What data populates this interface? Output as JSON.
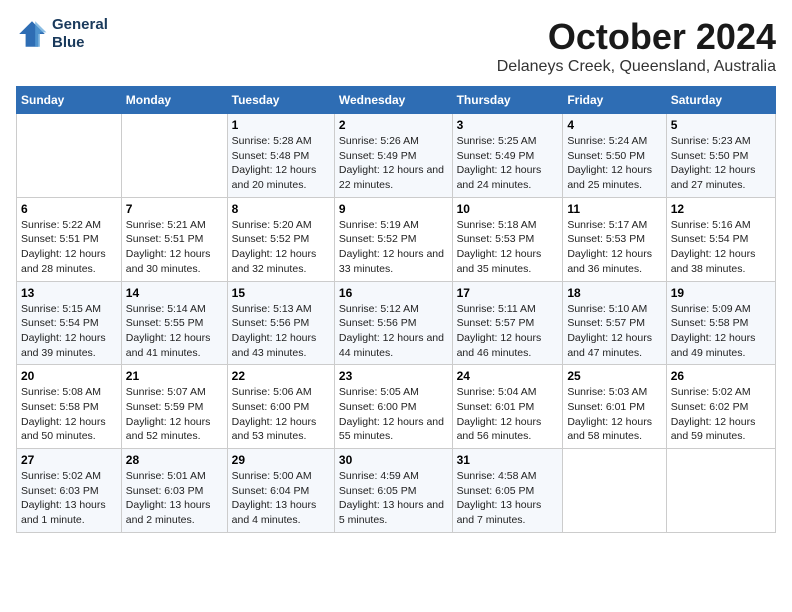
{
  "header": {
    "logo_line1": "General",
    "logo_line2": "Blue",
    "title": "October 2024",
    "subtitle": "Delaneys Creek, Queensland, Australia"
  },
  "weekdays": [
    "Sunday",
    "Monday",
    "Tuesday",
    "Wednesday",
    "Thursday",
    "Friday",
    "Saturday"
  ],
  "weeks": [
    [
      {
        "day": "",
        "sunrise": "",
        "sunset": "",
        "daylight": ""
      },
      {
        "day": "",
        "sunrise": "",
        "sunset": "",
        "daylight": ""
      },
      {
        "day": "1",
        "sunrise": "Sunrise: 5:28 AM",
        "sunset": "Sunset: 5:48 PM",
        "daylight": "Daylight: 12 hours and 20 minutes."
      },
      {
        "day": "2",
        "sunrise": "Sunrise: 5:26 AM",
        "sunset": "Sunset: 5:49 PM",
        "daylight": "Daylight: 12 hours and 22 minutes."
      },
      {
        "day": "3",
        "sunrise": "Sunrise: 5:25 AM",
        "sunset": "Sunset: 5:49 PM",
        "daylight": "Daylight: 12 hours and 24 minutes."
      },
      {
        "day": "4",
        "sunrise": "Sunrise: 5:24 AM",
        "sunset": "Sunset: 5:50 PM",
        "daylight": "Daylight: 12 hours and 25 minutes."
      },
      {
        "day": "5",
        "sunrise": "Sunrise: 5:23 AM",
        "sunset": "Sunset: 5:50 PM",
        "daylight": "Daylight: 12 hours and 27 minutes."
      }
    ],
    [
      {
        "day": "6",
        "sunrise": "Sunrise: 5:22 AM",
        "sunset": "Sunset: 5:51 PM",
        "daylight": "Daylight: 12 hours and 28 minutes."
      },
      {
        "day": "7",
        "sunrise": "Sunrise: 5:21 AM",
        "sunset": "Sunset: 5:51 PM",
        "daylight": "Daylight: 12 hours and 30 minutes."
      },
      {
        "day": "8",
        "sunrise": "Sunrise: 5:20 AM",
        "sunset": "Sunset: 5:52 PM",
        "daylight": "Daylight: 12 hours and 32 minutes."
      },
      {
        "day": "9",
        "sunrise": "Sunrise: 5:19 AM",
        "sunset": "Sunset: 5:52 PM",
        "daylight": "Daylight: 12 hours and 33 minutes."
      },
      {
        "day": "10",
        "sunrise": "Sunrise: 5:18 AM",
        "sunset": "Sunset: 5:53 PM",
        "daylight": "Daylight: 12 hours and 35 minutes."
      },
      {
        "day": "11",
        "sunrise": "Sunrise: 5:17 AM",
        "sunset": "Sunset: 5:53 PM",
        "daylight": "Daylight: 12 hours and 36 minutes."
      },
      {
        "day": "12",
        "sunrise": "Sunrise: 5:16 AM",
        "sunset": "Sunset: 5:54 PM",
        "daylight": "Daylight: 12 hours and 38 minutes."
      }
    ],
    [
      {
        "day": "13",
        "sunrise": "Sunrise: 5:15 AM",
        "sunset": "Sunset: 5:54 PM",
        "daylight": "Daylight: 12 hours and 39 minutes."
      },
      {
        "day": "14",
        "sunrise": "Sunrise: 5:14 AM",
        "sunset": "Sunset: 5:55 PM",
        "daylight": "Daylight: 12 hours and 41 minutes."
      },
      {
        "day": "15",
        "sunrise": "Sunrise: 5:13 AM",
        "sunset": "Sunset: 5:56 PM",
        "daylight": "Daylight: 12 hours and 43 minutes."
      },
      {
        "day": "16",
        "sunrise": "Sunrise: 5:12 AM",
        "sunset": "Sunset: 5:56 PM",
        "daylight": "Daylight: 12 hours and 44 minutes."
      },
      {
        "day": "17",
        "sunrise": "Sunrise: 5:11 AM",
        "sunset": "Sunset: 5:57 PM",
        "daylight": "Daylight: 12 hours and 46 minutes."
      },
      {
        "day": "18",
        "sunrise": "Sunrise: 5:10 AM",
        "sunset": "Sunset: 5:57 PM",
        "daylight": "Daylight: 12 hours and 47 minutes."
      },
      {
        "day": "19",
        "sunrise": "Sunrise: 5:09 AM",
        "sunset": "Sunset: 5:58 PM",
        "daylight": "Daylight: 12 hours and 49 minutes."
      }
    ],
    [
      {
        "day": "20",
        "sunrise": "Sunrise: 5:08 AM",
        "sunset": "Sunset: 5:58 PM",
        "daylight": "Daylight: 12 hours and 50 minutes."
      },
      {
        "day": "21",
        "sunrise": "Sunrise: 5:07 AM",
        "sunset": "Sunset: 5:59 PM",
        "daylight": "Daylight: 12 hours and 52 minutes."
      },
      {
        "day": "22",
        "sunrise": "Sunrise: 5:06 AM",
        "sunset": "Sunset: 6:00 PM",
        "daylight": "Daylight: 12 hours and 53 minutes."
      },
      {
        "day": "23",
        "sunrise": "Sunrise: 5:05 AM",
        "sunset": "Sunset: 6:00 PM",
        "daylight": "Daylight: 12 hours and 55 minutes."
      },
      {
        "day": "24",
        "sunrise": "Sunrise: 5:04 AM",
        "sunset": "Sunset: 6:01 PM",
        "daylight": "Daylight: 12 hours and 56 minutes."
      },
      {
        "day": "25",
        "sunrise": "Sunrise: 5:03 AM",
        "sunset": "Sunset: 6:01 PM",
        "daylight": "Daylight: 12 hours and 58 minutes."
      },
      {
        "day": "26",
        "sunrise": "Sunrise: 5:02 AM",
        "sunset": "Sunset: 6:02 PM",
        "daylight": "Daylight: 12 hours and 59 minutes."
      }
    ],
    [
      {
        "day": "27",
        "sunrise": "Sunrise: 5:02 AM",
        "sunset": "Sunset: 6:03 PM",
        "daylight": "Daylight: 13 hours and 1 minute."
      },
      {
        "day": "28",
        "sunrise": "Sunrise: 5:01 AM",
        "sunset": "Sunset: 6:03 PM",
        "daylight": "Daylight: 13 hours and 2 minutes."
      },
      {
        "day": "29",
        "sunrise": "Sunrise: 5:00 AM",
        "sunset": "Sunset: 6:04 PM",
        "daylight": "Daylight: 13 hours and 4 minutes."
      },
      {
        "day": "30",
        "sunrise": "Sunrise: 4:59 AM",
        "sunset": "Sunset: 6:05 PM",
        "daylight": "Daylight: 13 hours and 5 minutes."
      },
      {
        "day": "31",
        "sunrise": "Sunrise: 4:58 AM",
        "sunset": "Sunset: 6:05 PM",
        "daylight": "Daylight: 13 hours and 7 minutes."
      },
      {
        "day": "",
        "sunrise": "",
        "sunset": "",
        "daylight": ""
      },
      {
        "day": "",
        "sunrise": "",
        "sunset": "",
        "daylight": ""
      }
    ]
  ]
}
